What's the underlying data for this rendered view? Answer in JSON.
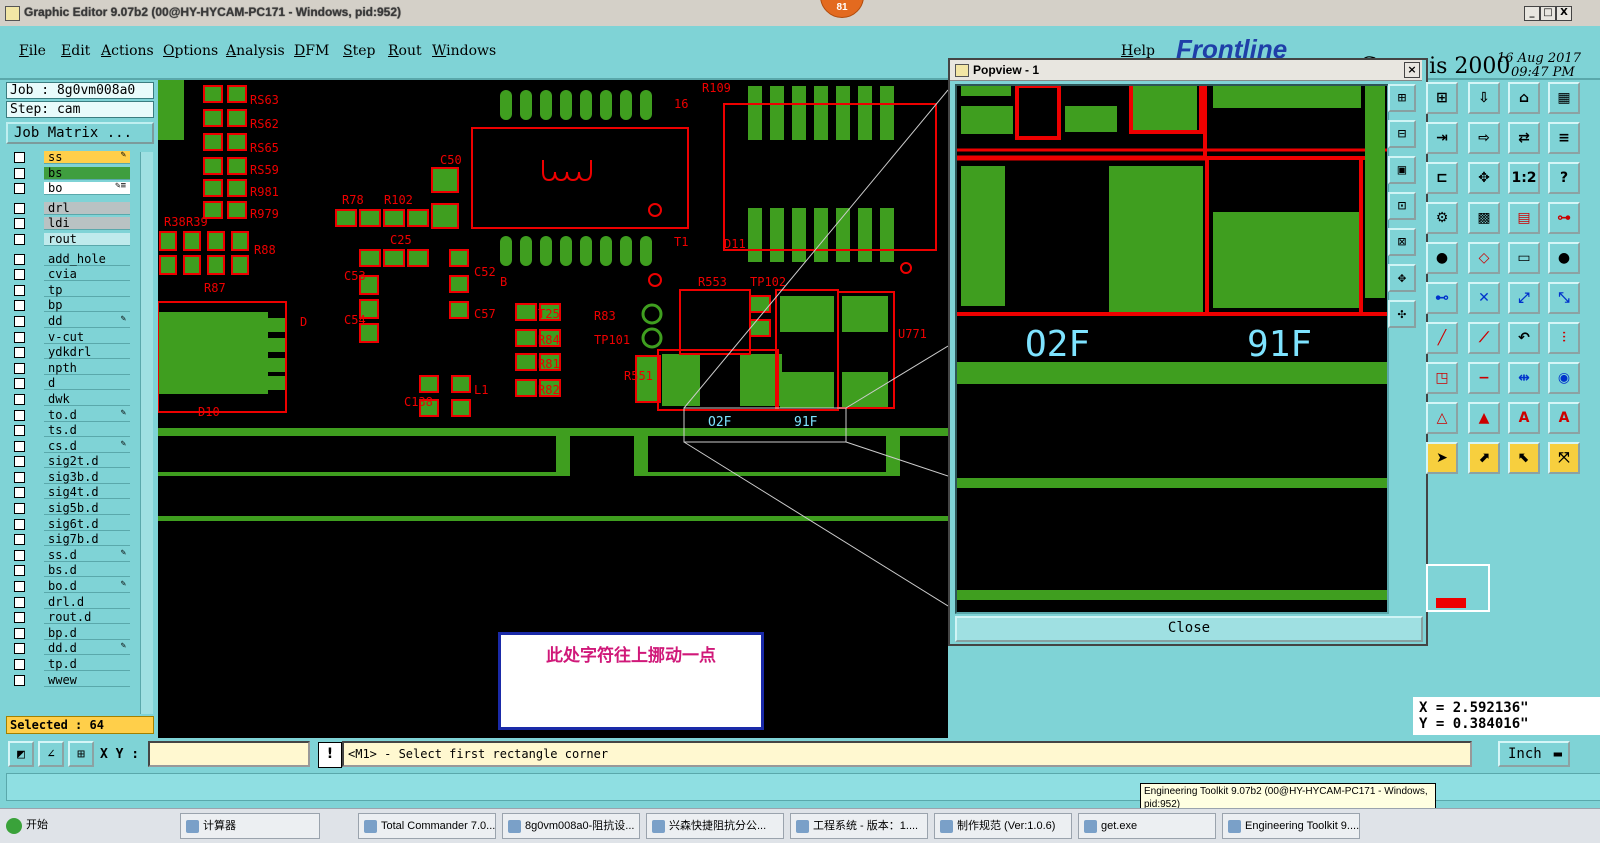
{
  "window": {
    "title": "Graphic Editor 9.07b2 (00@HY-HYCAM-PC171 - Windows, pid:952)",
    "badge": "81",
    "minimize": "_",
    "maximize": "□",
    "close": "X"
  },
  "menu": {
    "items": [
      "File",
      "Edit",
      "Actions",
      "Options",
      "Analysis",
      "DFM",
      "Step",
      "Rout",
      "Windows"
    ],
    "help": "Help",
    "brand": "Frontline",
    "product": "Genesis 2000",
    "date": "16 Aug 2017",
    "time": "09:47 PM"
  },
  "job": {
    "job_label": "Job : 8g0vm008a0",
    "step_label": "Step: cam",
    "matrix_button": "Job Matrix ..."
  },
  "layers": [
    {
      "name": "ss",
      "style": "hl-yellow",
      "mark": "✎"
    },
    {
      "name": "bs",
      "style": "hl-green",
      "mark": ""
    },
    {
      "name": "bo",
      "style": "hl-white",
      "mark": "✎≡"
    },
    {
      "name": "drl",
      "style": "gray",
      "mark": ""
    },
    {
      "name": "ldi",
      "style": "gray",
      "mark": ""
    },
    {
      "name": "rout",
      "style": "light",
      "mark": ""
    },
    {
      "name": "add_hole",
      "style": "",
      "mark": ""
    },
    {
      "name": "cvia",
      "style": "",
      "mark": ""
    },
    {
      "name": "tp",
      "style": "",
      "mark": ""
    },
    {
      "name": "bp",
      "style": "",
      "mark": ""
    },
    {
      "name": "dd",
      "style": "",
      "mark": "✎"
    },
    {
      "name": "v-cut",
      "style": "",
      "mark": ""
    },
    {
      "name": "ydkdrl",
      "style": "",
      "mark": ""
    },
    {
      "name": "npth",
      "style": "",
      "mark": ""
    },
    {
      "name": "d",
      "style": "",
      "mark": ""
    },
    {
      "name": "dwk",
      "style": "",
      "mark": ""
    },
    {
      "name": "to.d",
      "style": "",
      "mark": "✎"
    },
    {
      "name": "ts.d",
      "style": "",
      "mark": ""
    },
    {
      "name": "cs.d",
      "style": "",
      "mark": "✎"
    },
    {
      "name": "sig2t.d",
      "style": "",
      "mark": ""
    },
    {
      "name": "sig3b.d",
      "style": "",
      "mark": ""
    },
    {
      "name": "sig4t.d",
      "style": "",
      "mark": ""
    },
    {
      "name": "sig5b.d",
      "style": "",
      "mark": ""
    },
    {
      "name": "sig6t.d",
      "style": "",
      "mark": ""
    },
    {
      "name": "sig7b.d",
      "style": "",
      "mark": ""
    },
    {
      "name": "ss.d",
      "style": "",
      "mark": "✎"
    },
    {
      "name": "bs.d",
      "style": "",
      "mark": ""
    },
    {
      "name": "bo.d",
      "style": "",
      "mark": "✎"
    },
    {
      "name": "drl.d",
      "style": "",
      "mark": ""
    },
    {
      "name": "rout.d",
      "style": "",
      "mark": ""
    },
    {
      "name": "bp.d",
      "style": "",
      "mark": ""
    },
    {
      "name": "dd.d",
      "style": "",
      "mark": "✎"
    },
    {
      "name": "tp.d",
      "style": "",
      "mark": ""
    },
    {
      "name": "wwew",
      "style": "",
      "mark": ""
    }
  ],
  "selected": "Selected : 64",
  "canvas": {
    "refs": [
      "RS63",
      "RS62",
      "RS65",
      "RS59",
      "R981",
      "R979",
      "R38",
      "R39",
      "R87",
      "R88",
      "R78",
      "R102",
      "C50",
      "C25",
      "C53",
      "C54",
      "C52",
      "C57",
      "C58",
      "C59",
      "R109",
      "T25",
      "T1",
      "D11",
      "R553",
      "TP102",
      "R83",
      "TP101",
      "R84",
      "R81",
      "R82",
      "R551",
      "C138",
      "L1",
      "D10",
      "D",
      "U771",
      "16",
      "B",
      "O2F",
      "91F"
    ],
    "note": "此处字符往上挪动一点"
  },
  "popview": {
    "title": "Popview - 1",
    "close_label": "Close",
    "label_left": "O2F",
    "label_right": "91F"
  },
  "coords": {
    "x": "X = 2.592136\"",
    "y": "Y = 0.384016\""
  },
  "bottom": {
    "xy_label": "X Y :",
    "xy_value": "",
    "excl": "!",
    "prompt": "<M1> - Select first rectangle corner",
    "units": "Inch"
  },
  "tooltip": "Engineering Toolkit 9.07b2 (00@HY-HYCAM-PC171 - Windows, pid:952)",
  "taskbar": {
    "start": "开始",
    "tasks": [
      "计算器",
      "Total Commander 7.0...",
      "8g0vm008a0-阻抗设...",
      "兴森快捷阻抗分公...",
      "工程系统 - 版本：1....",
      "制作规范 (Ver:1.0.6)",
      "get.exe",
      "Engineering Toolkit 9...."
    ]
  }
}
